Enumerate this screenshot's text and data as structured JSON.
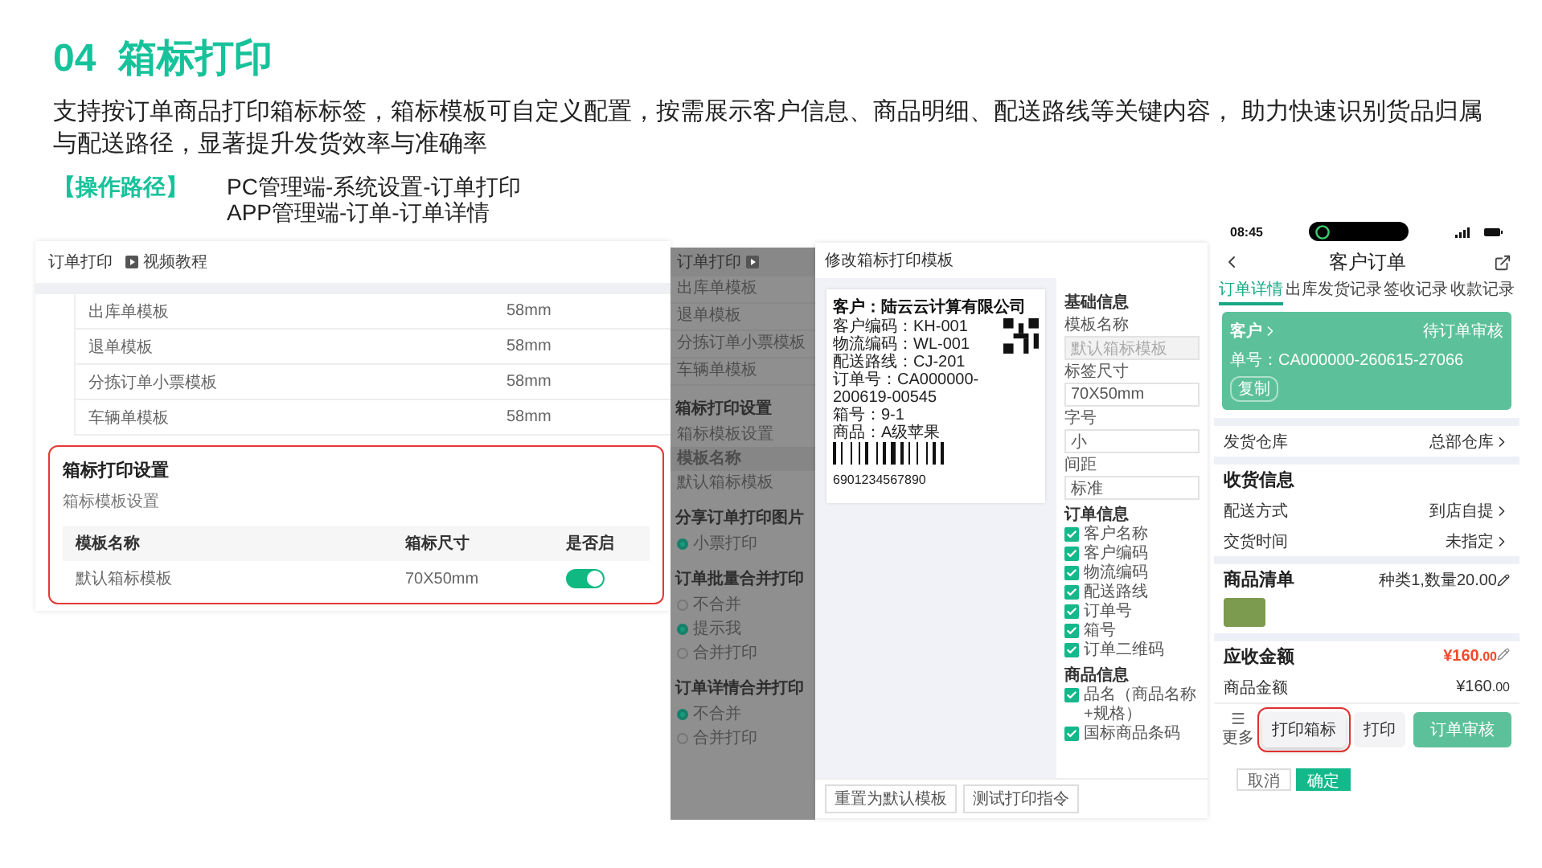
{
  "title": {
    "number": "04",
    "text": "箱标打印"
  },
  "description": "支持按订单商品打印箱标标签，箱标模板可自定义配置，按需展示客户信息、商品明细、配送路线等关键内容， 助力快速识别货品归属与配送路径，显著提升发货效率与准确率",
  "operation_path": {
    "label": "【操作路径】",
    "steps": [
      "PC管理端-系统设置-订单打印",
      "APP管理端-订单-订单详情"
    ]
  },
  "pc_settings": {
    "title": "订单打印",
    "video_link": "视频教程",
    "template_rows": [
      {
        "name": "出库单模板",
        "size": "58mm"
      },
      {
        "name": "退单模板",
        "size": "58mm"
      },
      {
        "name": "分拣订单小票模板",
        "size": "58mm"
      },
      {
        "name": "车辆单模板",
        "size": "58mm"
      }
    ],
    "box_label_section": {
      "highlighted": true,
      "title": "箱标打印设置",
      "subtitle": "箱标模板设置",
      "columns": [
        "模板名称",
        "箱标尺寸",
        "是否启"
      ],
      "rows": [
        {
          "name": "默认箱标模板",
          "size": "70X50mm",
          "enabled": true
        }
      ]
    }
  },
  "overlay_page": {
    "title": "订单打印",
    "template_rows": [
      "出库单模板",
      "退单模板",
      "分拣订单小票模板",
      "车辆单模板"
    ],
    "sections": [
      {
        "title": "箱标打印设置",
        "items": [
          {
            "kind": "subtitle",
            "text": "箱标模板设置"
          },
          {
            "kind": "table_header",
            "text": "模板名称"
          },
          {
            "kind": "table_row",
            "text": "默认箱标模板"
          }
        ]
      },
      {
        "title": "分享订单打印图片",
        "items": [
          {
            "kind": "radio",
            "text": "小票打印",
            "selected": true
          }
        ]
      },
      {
        "title": "订单批量合并打印",
        "items": [
          {
            "kind": "radio",
            "text": "不合并",
            "selected": false
          },
          {
            "kind": "radio",
            "text": "提示我",
            "selected": true
          },
          {
            "kind": "radio",
            "text": "合并打印",
            "selected": false
          }
        ]
      },
      {
        "title": "订单详情合并打印",
        "items": [
          {
            "kind": "radio",
            "text": "不合并",
            "selected": true
          },
          {
            "kind": "radio",
            "text": "合并打印",
            "selected": false
          }
        ]
      }
    ]
  },
  "template_modal": {
    "title": "修改箱标打印模板",
    "preview": {
      "customer": "客户：陆云云计算有限公司",
      "lines": [
        "客户编码：KH-001",
        "物流编码：WL-001",
        "配送路线：CJ-201",
        "订单号：CA000000-200619-00545",
        "箱号：9-1",
        "商品：A级苹果"
      ],
      "barcode_number": "6901234567890"
    },
    "basic_title": "基础信息",
    "fields": [
      {
        "label": "模板名称",
        "value": "默认箱标模板",
        "disabled": true
      },
      {
        "label": "标签尺寸",
        "value": "70X50mm",
        "disabled": false
      },
      {
        "label": "字号",
        "value": "小",
        "disabled": false
      },
      {
        "label": "间距",
        "value": "标准",
        "disabled": false
      }
    ],
    "option_groups": [
      {
        "title": "订单信息",
        "options": [
          {
            "label": "客户名称",
            "checked": true
          },
          {
            "label": "客户编码",
            "checked": true
          },
          {
            "label": "物流编码",
            "checked": true
          },
          {
            "label": "配送路线",
            "checked": true
          },
          {
            "label": "订单号",
            "checked": true
          },
          {
            "label": "箱号",
            "checked": true
          },
          {
            "label": "订单二维码",
            "checked": true
          }
        ]
      },
      {
        "title": "商品信息",
        "options": [
          {
            "label": "品名（商品名称+规格）",
            "checked": true
          },
          {
            "label": "国标商品条码",
            "checked": true
          }
        ]
      }
    ],
    "buttons": [
      "重置为默认模板",
      "测试打印指令"
    ]
  },
  "phone": {
    "time": "08:45",
    "nav_title": "客户订单",
    "tabs": [
      {
        "label": "订单详情",
        "selected": true
      },
      {
        "label": "出库发货记录",
        "selected": false
      },
      {
        "label": "签收记录",
        "selected": false
      },
      {
        "label": "收款记录",
        "selected": false
      }
    ],
    "customer_card": {
      "name": "客户",
      "status": "待订单审核",
      "order_no": "单号：CA000000-260615-27066",
      "copy": "复制"
    },
    "warehouse": {
      "label": "发货仓库",
      "value": "总部仓库"
    },
    "receiving": {
      "title": "收货信息",
      "rows": [
        {
          "label": "配送方式",
          "value": "到店自提"
        },
        {
          "label": "交货时间",
          "value": "未指定"
        }
      ]
    },
    "goods": {
      "title": "商品清单",
      "summary": "种类1,数量20.00"
    },
    "receivable": {
      "title": "应收金额",
      "amount": "¥160",
      "decimals": ".00"
    },
    "goods_amount": {
      "label": "商品金额",
      "amount": "¥160",
      "decimals": ".00"
    },
    "more": "更多",
    "buttons": [
      {
        "label": "打印箱标",
        "kind": "outline",
        "highlighted": true
      },
      {
        "label": "打印",
        "kind": "outline",
        "highlighted": false
      },
      {
        "label": "订单审核",
        "kind": "primary",
        "highlighted": false
      }
    ]
  },
  "dialog_buttons": [
    {
      "label": "取消",
      "kind": "default"
    },
    {
      "label": "确定",
      "kind": "primary"
    }
  ]
}
